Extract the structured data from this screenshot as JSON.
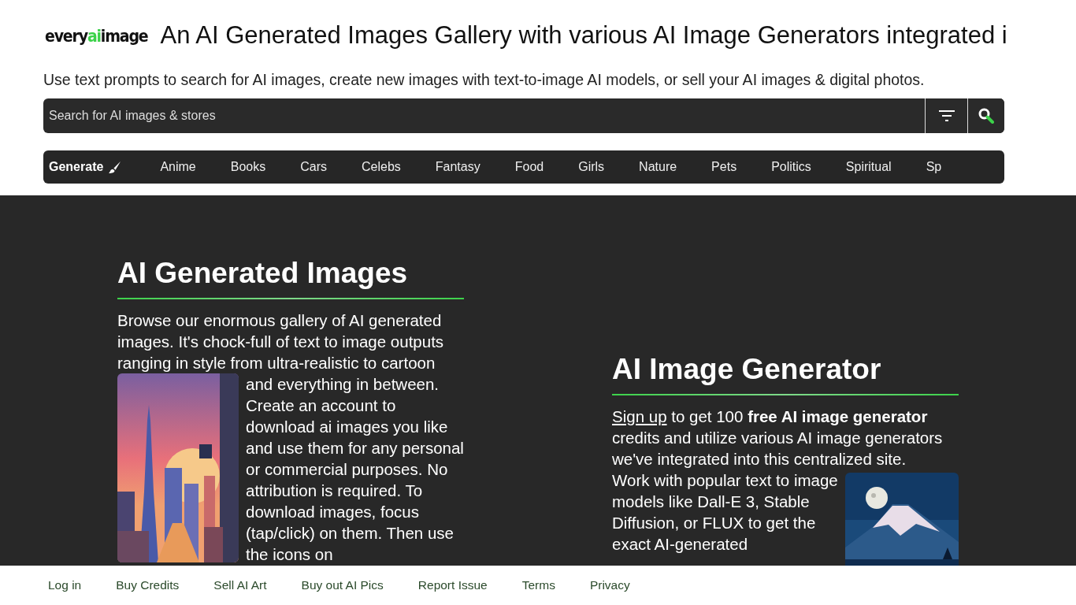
{
  "header": {
    "logo": {
      "prefix": "every",
      "accent": "ai",
      "suffix": "image"
    },
    "title": "An AI Generated Images Gallery with various AI Image Generators integrated i",
    "subtitle": "Use text prompts to search for AI images, create new images with text-to-image AI models, or sell your AI images & digital photos.",
    "search": {
      "placeholder": "Search for AI images & stores"
    }
  },
  "nav": [
    {
      "label": "Generate",
      "kind": "action"
    },
    {
      "label": "Anime",
      "kind": "category"
    },
    {
      "label": "Books",
      "kind": "category"
    },
    {
      "label": "Cars",
      "kind": "category"
    },
    {
      "label": "Celebs",
      "kind": "category"
    },
    {
      "label": "Fantasy",
      "kind": "category"
    },
    {
      "label": "Food",
      "kind": "category"
    },
    {
      "label": "Girls",
      "kind": "category"
    },
    {
      "label": "Nature",
      "kind": "category"
    },
    {
      "label": "Pets",
      "kind": "category"
    },
    {
      "label": "Politics",
      "kind": "category"
    },
    {
      "label": "Spiritual",
      "kind": "category"
    },
    {
      "label": "Sp",
      "kind": "category"
    }
  ],
  "gallery": {
    "heading": "AI Generated Images",
    "intro": "Browse our enormous gallery of AI generated images. It's chock-full of text to image outputs ranging in style from ultra-realistic to cartoon",
    "text": "and everything in between. Create an account to download ai images you like and use them for any personal or commercial purposes. No attribution is required. To download images, focus (tap/click) on them. Then use the icons on"
  },
  "generator": {
    "heading": "AI Image Generator",
    "link": "Sign up",
    "intro": " to get 100 **free AI image generator** credits and utilize various AI image generators we've integrated into this centralized site.",
    "text": "Work with popular text to image models like Dall-E 3, Stable Diffusion, or FLUX to get the exact AI-generated"
  },
  "footer": [
    "Log in",
    "Buy Credits",
    "Sell AI Art",
    "Buy out AI Pics",
    "Report Issue",
    "Terms",
    "Privacy"
  ]
}
